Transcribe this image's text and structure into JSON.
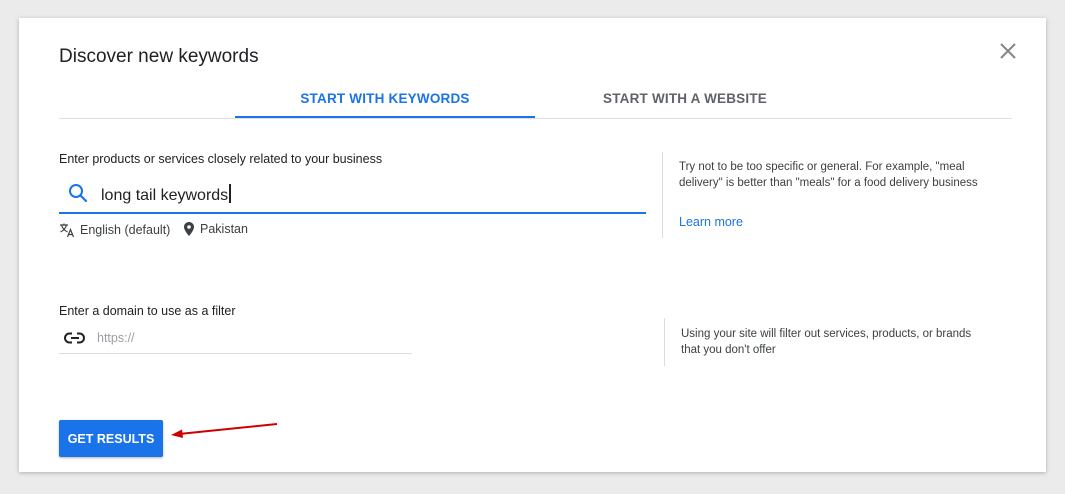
{
  "dialog": {
    "title": "Discover new keywords",
    "close_icon": "close-icon"
  },
  "tabs": [
    {
      "label": "START WITH KEYWORDS",
      "active": true
    },
    {
      "label": "START WITH A WEBSITE",
      "active": false
    }
  ],
  "keywords_section": {
    "label": "Enter products or services closely related to your business",
    "input_value": "long tail keywords",
    "search_icon": "search-icon",
    "language": "English (default)",
    "location": "Pakistan",
    "help_text": "Try not to be too specific or general. For example, \"meal delivery\" is better than \"meals\" for a food delivery business",
    "learn_more": "Learn more"
  },
  "domain_section": {
    "label": "Enter a domain to use as a filter",
    "placeholder": "https://",
    "link_icon": "link-icon",
    "help_text": "Using your site will filter out services, products, or brands that you don't offer"
  },
  "actions": {
    "get_results_label": "GET RESULTS"
  },
  "colors": {
    "accent": "#1a73e8",
    "annotation_arrow": "#cc0000"
  }
}
